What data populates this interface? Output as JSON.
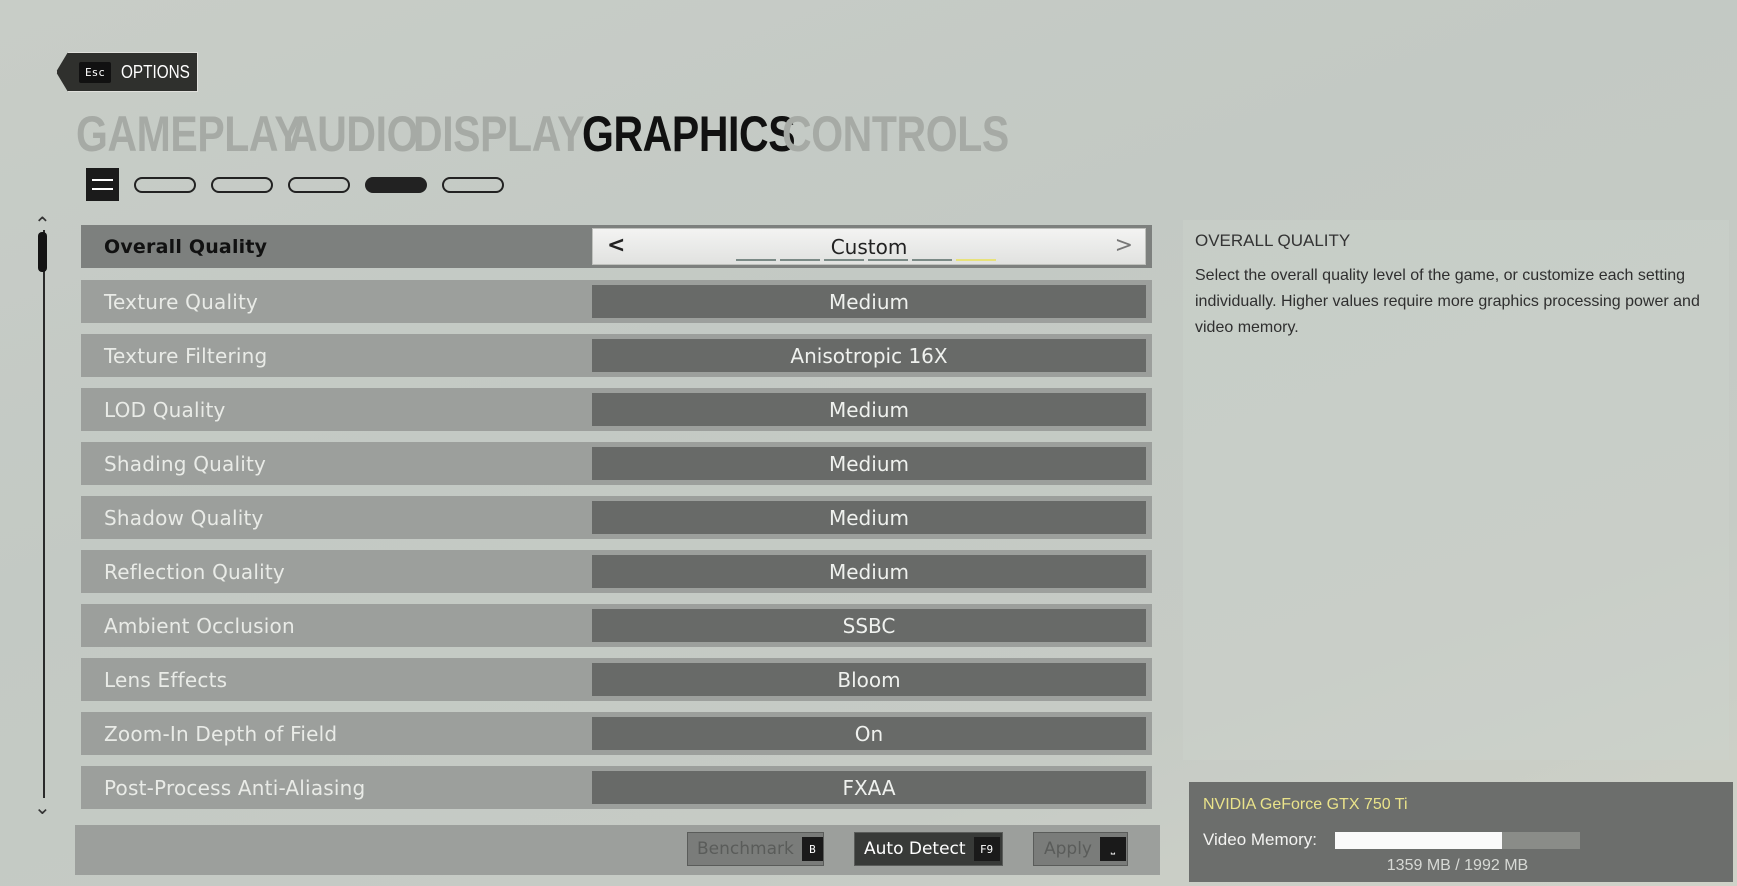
{
  "header": {
    "back": {
      "key": "Esc",
      "label": "OPTIONS"
    },
    "tabs": [
      {
        "label": "GAMEPLAY",
        "active": false
      },
      {
        "label": "AUDIO",
        "active": false
      },
      {
        "label": "DISPLAY",
        "active": false
      },
      {
        "label": "GRAPHICS",
        "active": true
      },
      {
        "label": "CONTROLS",
        "active": false
      }
    ],
    "subtab_icon": "preset-sliders-icon",
    "subtab_active_index": 4,
    "subtab_count": 5
  },
  "settings": [
    {
      "label": "Overall Quality",
      "value": "Custom",
      "selected": true,
      "segments": 6,
      "active_segment": 6
    },
    {
      "label": "Texture Quality",
      "value": "Medium"
    },
    {
      "label": "Texture Filtering",
      "value": "Anisotropic 16X"
    },
    {
      "label": "LOD Quality",
      "value": "Medium"
    },
    {
      "label": "Shading Quality",
      "value": "Medium"
    },
    {
      "label": "Shadow Quality",
      "value": "Medium"
    },
    {
      "label": "Reflection Quality",
      "value": "Medium"
    },
    {
      "label": "Ambient Occlusion",
      "value": "SSBC"
    },
    {
      "label": "Lens Effects",
      "value": "Bloom"
    },
    {
      "label": "Zoom-In Depth of Field",
      "value": "On"
    },
    {
      "label": "Post-Process Anti-Aliasing",
      "value": "FXAA"
    }
  ],
  "actions": {
    "benchmark": {
      "label": "Benchmark",
      "key": "B",
      "enabled": false
    },
    "auto_detect": {
      "label": "Auto Detect",
      "key": "F9",
      "enabled": true
    },
    "apply": {
      "label": "Apply",
      "key": "⎵",
      "enabled": false
    }
  },
  "description": {
    "title": "OVERALL QUALITY",
    "text": "Select the overall quality level of the game, or customize each setting individually. Higher values require more graphics processing power and video memory."
  },
  "gpu": {
    "name": "NVIDIA GeForce GTX 750 Ti",
    "video_memory_label": "Video Memory:",
    "video_memory_text": "1359 MB / 1992 MB",
    "used_fraction": 0.682
  },
  "colors": {
    "accent_yellow": "#e8e27a",
    "active_tab": "#111111",
    "inactive_tab": "#a6aaa5"
  }
}
